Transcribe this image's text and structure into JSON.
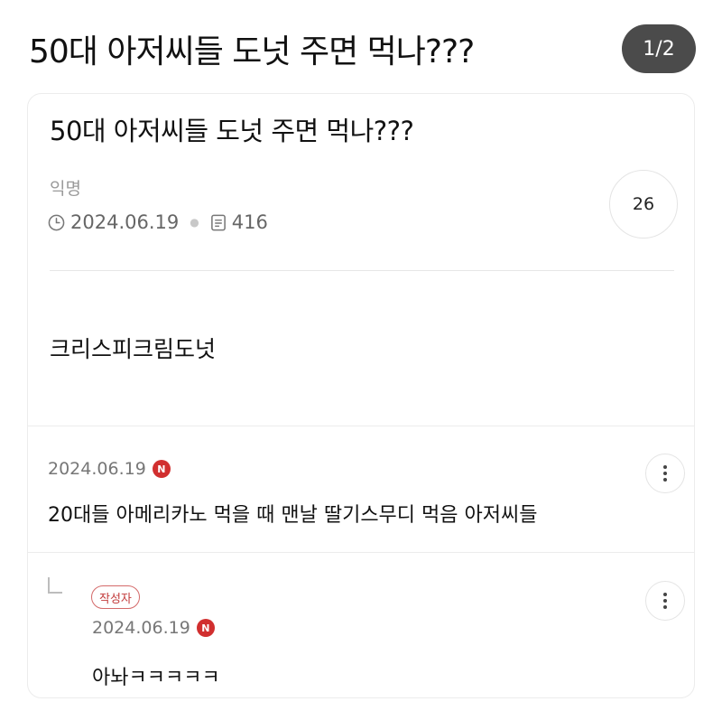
{
  "page": {
    "title": "50대 아저씨들 도넛 주면 먹나???",
    "indicator": "1/2"
  },
  "post": {
    "title": "50대 아저씨들 도넛 주면 먹나???",
    "author": "익명",
    "date": "2024.06.19",
    "views": "416",
    "comment_count": "26",
    "body": "크리스피크림도넛"
  },
  "comments": [
    {
      "date": "2024.06.19",
      "new_badge": "N",
      "text": "20대들 아메리카노 먹을 때 맨날 딸기스무디 먹음 아저씨들"
    }
  ],
  "replies": [
    {
      "badge": "작성자",
      "date": "2024.06.19",
      "new_badge": "N",
      "text": "아놔ㅋㅋㅋㅋㅋ"
    }
  ],
  "colors": {
    "indicator_bg": "#4b4b4b",
    "new_badge": "#d12f2f",
    "author_badge": "#c23a3a"
  },
  "icons": {
    "date": "clock-icon",
    "views": "document-icon",
    "more": "more-vertical-icon",
    "reply": "reply-arrow-icon"
  }
}
